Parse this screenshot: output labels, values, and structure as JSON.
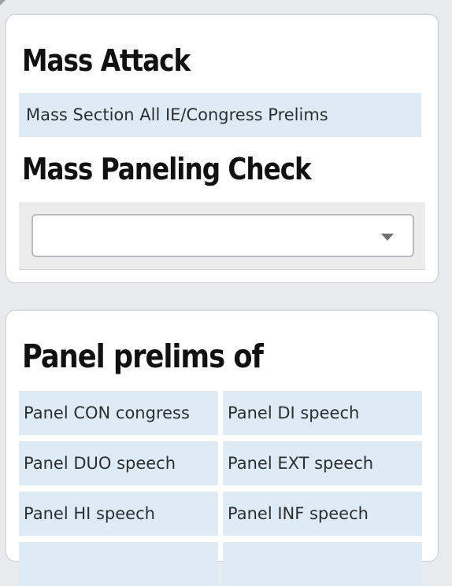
{
  "mass_attack": {
    "title": "Mass Attack",
    "mass_section_link": "Mass Section All IE/Congress Prelims",
    "paneling_title": "Mass Paneling Check",
    "paneling_select_value": ""
  },
  "panel_prelims": {
    "title": "Panel prelims of",
    "items": [
      "Panel CON congress",
      "Panel DI speech",
      "Panel DUO speech",
      "Panel EXT speech",
      "Panel HI speech",
      "Panel INF speech",
      "",
      ""
    ]
  },
  "colors": {
    "background": "#e8ebed",
    "card": "#ffffff",
    "link_bar": "#deebf4",
    "select_well": "#ececec"
  },
  "icons": {
    "select_caret": "chevron-down-icon",
    "corner": "triangle-icon"
  }
}
